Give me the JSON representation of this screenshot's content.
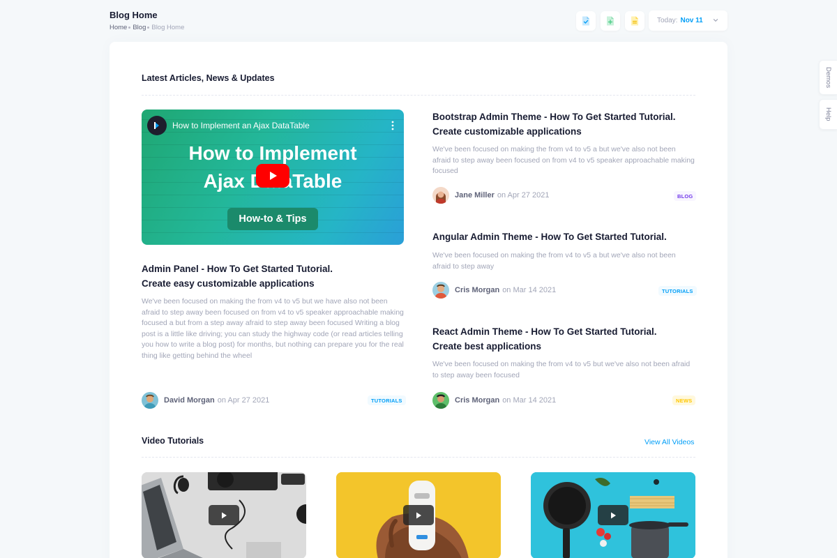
{
  "toolbar": {
    "title": "Blog Home",
    "breadcrumb": [
      "Home",
      "Blog",
      "Blog Home"
    ],
    "date_label": "Today:",
    "date_value": "Nov 11"
  },
  "side_tabs": [
    "Demos",
    "Help"
  ],
  "latest": {
    "heading": "Latest Articles, News & Updates",
    "video": {
      "channel_title": "How to Implement an Ajax DataTable",
      "headline_line1": "How to Implement",
      "headline_line2": "Ajax DataTable",
      "tag": "How-to & Tips"
    },
    "main_article": {
      "title_line1": "Admin Panel - How To Get Started Tutorial.",
      "title_line2": "Create easy customizable applications",
      "text": "We've been focused on making the from v4 to v5 but we have also not been afraid to step away been focused on from v4 to v5 speaker approachable making focused a but from a step away afraid to step away been focused Writing a blog post is a little like driving; you can study the highway code (or read articles telling you how to write a blog post) for months, but nothing can prepare you for the real thing like getting behind the wheel",
      "author": "David Morgan",
      "date": "on Apr 27 2021",
      "badge": "TUTORIALS"
    },
    "side_articles": [
      {
        "title_line1": "Bootstrap Admin Theme - How To Get Started Tutorial.",
        "title_line2": "Create customizable applications",
        "text": "We've been focused on making the from v4 to v5 a but we've also not been afraid to step away been focused on from v4 to v5 speaker approachable making focused",
        "author": "Jane Miller",
        "date": "on Apr 27 2021",
        "badge": "BLOG"
      },
      {
        "title_line1": "Angular Admin Theme - How To Get Started Tutorial.",
        "title_line2": "",
        "text": "We've been focused on making the from v4 to v5 a but we've also not been afraid to step away",
        "author": "Cris Morgan",
        "date": "on Mar 14 2021",
        "badge": "TUTORIALS"
      },
      {
        "title_line1": "React Admin Theme - How To Get Started Tutorial.",
        "title_line2": "Create best applications",
        "text": "We've been focused on making the from v4 to v5 but we've also not been afraid to step away been focused",
        "author": "Cris Morgan",
        "date": "on Mar 14 2021",
        "badge": "NEWS"
      }
    ]
  },
  "videos": {
    "heading": "Video Tutorials",
    "view_all": "View All Videos",
    "thumbnails": [
      "desk-workspace",
      "hand-device",
      "cooking-pans"
    ]
  },
  "icons": {
    "toolbar": [
      "file-check-icon",
      "file-plus-icon",
      "file-text-icon"
    ],
    "date": "chevron-down-icon"
  },
  "colors": {
    "primary": "#009ef7",
    "blog": "#7239ea",
    "news": "#ffc700",
    "success": "#50cd89",
    "page_bg": "#f5f8fa"
  }
}
